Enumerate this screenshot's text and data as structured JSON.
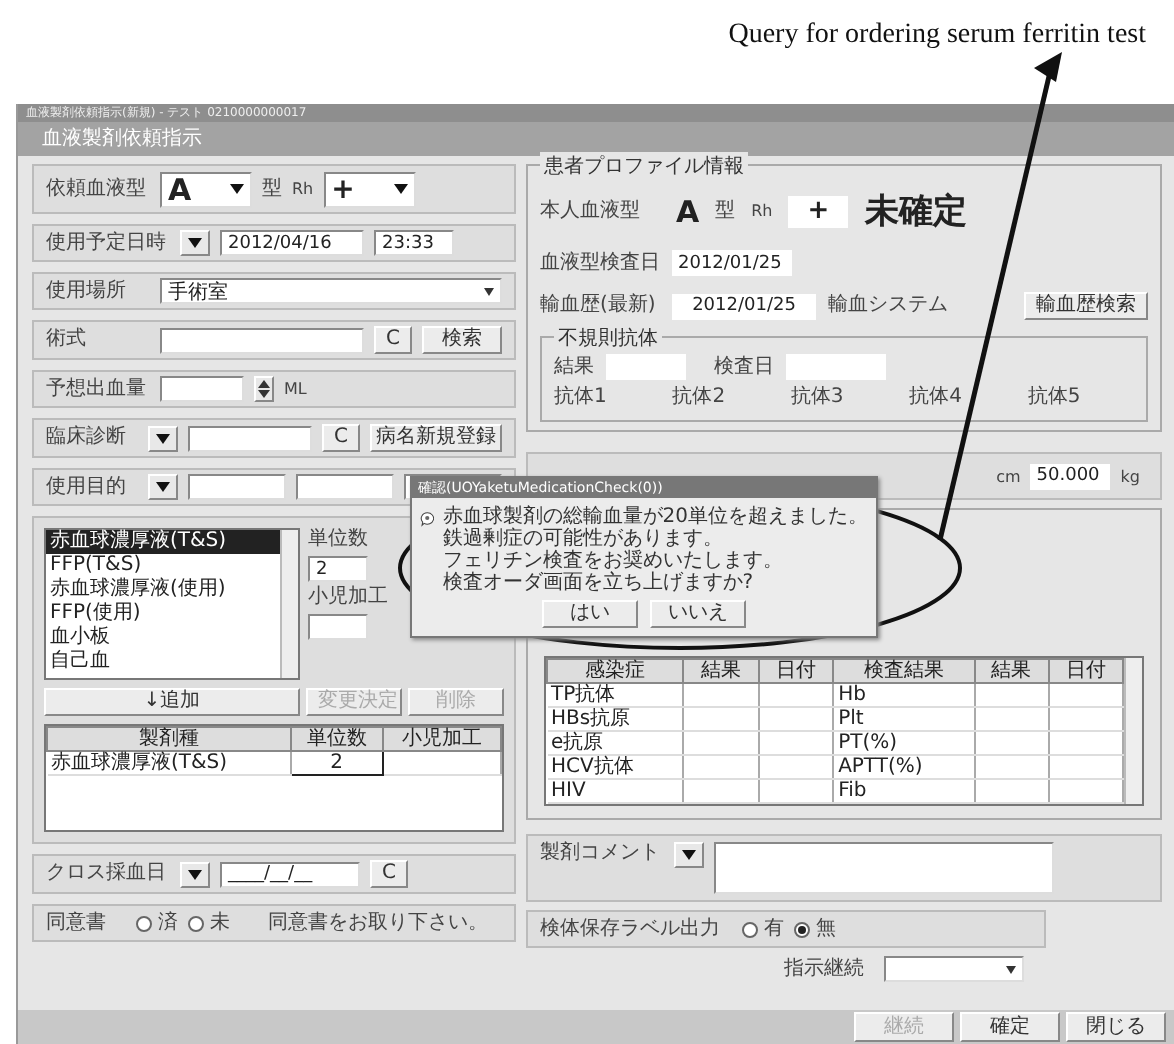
{
  "caption": "Query for ordering serum ferritin test",
  "window": {
    "title_bar": "血液製剤依頼指示(新規) - テスト 0210000000017",
    "title": "血液製剤依頼指示"
  },
  "left": {
    "blood_type": {
      "label": "依頼血液型",
      "abo": "A",
      "type_unit": "型",
      "rh_label": "Rh",
      "rh": "+"
    },
    "schedule": {
      "label": "使用予定日時",
      "date": "2012/04/16",
      "time": "23:33"
    },
    "place": {
      "label": "使用場所",
      "value": "手術室"
    },
    "procedure": {
      "label": "術式",
      "clear": "C",
      "button": "検索"
    },
    "bleeding": {
      "label": "予想出血量",
      "unit": "ML"
    },
    "diagnosis": {
      "label": "臨床診断",
      "clear": "C",
      "button": "病名新規登録"
    },
    "purpose": {
      "label": "使用目的"
    },
    "products": {
      "items": [
        {
          "label": "赤血球濃厚液(T&S)",
          "selected": true
        },
        {
          "label": "FFP(T&S)",
          "selected": false
        },
        {
          "label": "赤血球濃厚液(使用)",
          "selected": false
        },
        {
          "label": "FFP(使用)",
          "selected": false
        },
        {
          "label": "血小板",
          "selected": false
        },
        {
          "label": "自己血",
          "selected": false
        }
      ],
      "units_label": "単位数",
      "units": "2",
      "pediatric_label": "小児加工",
      "buttons": [
        {
          "label": "↓追加",
          "disabled": false
        },
        {
          "label": "変更決定",
          "disabled": true
        },
        {
          "label": "削除",
          "disabled": true
        }
      ],
      "table": {
        "columns": [
          "製剤種",
          "単位数",
          "小児加工"
        ],
        "rows": [
          {
            "product": "赤血球濃厚液(T&S)",
            "units": "2"
          }
        ]
      }
    },
    "cross": {
      "label": "クロス採血日",
      "value": "____/__/__",
      "clear": "C"
    },
    "consent": {
      "label": "同意書",
      "options": [
        {
          "label": "済",
          "selected": false
        },
        {
          "label": "未",
          "selected": false
        }
      ],
      "note": "同意書をお取り下さい。"
    }
  },
  "right": {
    "profile": {
      "title": "患者プロファイル情報",
      "own_type_label": "本人血液型",
      "abo": "A",
      "type_unit": "型",
      "rh_label": "Rh",
      "rh": "+",
      "status": "未確定",
      "test_date_label": "血液型検査日",
      "test_date": "2012/01/25",
      "history_label": "輸血歴(最新)",
      "history": "2012/01/25",
      "system_label": "輸血システム",
      "history_button": "輸血歴検索",
      "antibody": {
        "title": "不規則抗体",
        "result_label": "結果",
        "date_label": "検査日",
        "antibodies": [
          "抗体1",
          "抗体2",
          "抗体3",
          "抗体4",
          "抗体5"
        ]
      }
    },
    "body": {
      "height_unit": "cm",
      "weight": "50.000",
      "weight_unit": "kg"
    },
    "lab_table": {
      "columns": [
        "感染症",
        "結果",
        "日付",
        "検査結果",
        "結果",
        "日付"
      ],
      "rows": [
        {
          "infection": "TP抗体",
          "test": "Hb"
        },
        {
          "infection": "HBs抗原",
          "test": "Plt"
        },
        {
          "infection": "e抗原",
          "test": "PT(%)"
        },
        {
          "infection": "HCV抗体",
          "test": "APTT(%)"
        },
        {
          "infection": "HIV",
          "test": "Fib"
        }
      ]
    },
    "comment": {
      "label": "製剤コメント"
    },
    "label_output": {
      "label": "検体保存ラベル出力",
      "options": [
        {
          "label": "有",
          "selected": false
        },
        {
          "label": "無",
          "selected": true
        }
      ]
    },
    "continuation": {
      "label": "指示継続"
    }
  },
  "footer": {
    "buttons": [
      {
        "label": "継続",
        "disabled": true
      },
      {
        "label": "確定",
        "disabled": false
      },
      {
        "label": "閉じる",
        "disabled": false
      }
    ]
  },
  "dialog": {
    "title": "確認(UOYaketuMedicationCheck(0))",
    "lines": [
      "赤血球製剤の総輸血量が20単位を超えました。",
      "鉄過剰症の可能性があります。",
      "フェリチン検査をお奨めいたします。",
      "検査オーダ画面を立ち上げますか?"
    ],
    "buttons": [
      "はい",
      "いいえ"
    ]
  }
}
